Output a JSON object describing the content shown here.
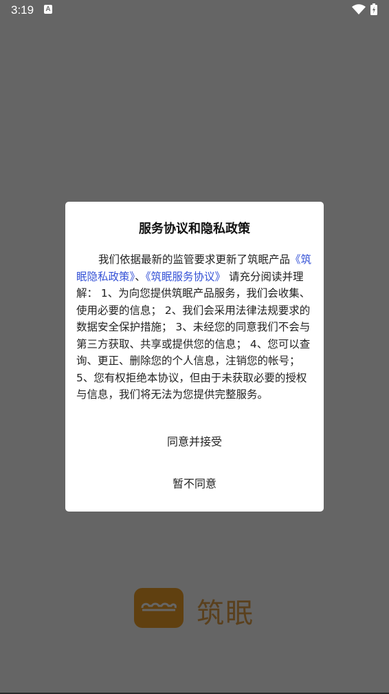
{
  "status_bar": {
    "time": "3:19",
    "notification_icon": "A"
  },
  "splash": {
    "app_name": "筑眠"
  },
  "dialog": {
    "title": "服务协议和隐私政策",
    "body_intro": "我们依据最新的监管要求更新了筑眠产品",
    "privacy_link": "《筑眠隐私政策》",
    "separator": "、",
    "service_link": "《筑眠服务协议》",
    "body_rest": " 请充分阅读并理解： 1、为向您提供筑眠产品服务，我们会收集、使用必要的信息； 2、我们会采用法律法规要求的数据安全保护措施； 3、未经您的同意我们不会与第三方获取、共享或提供您的信息； 4、您可以查询、更正、删除您的个人信息，注销您的帐号； 5、您有权拒绝本协议，但由于未获取必要的授权与信息，我们将无法为您提供完整服务。",
    "agree_label": "同意并接受",
    "disagree_label": "暂不同意"
  },
  "colors": {
    "link": "#3451d6",
    "brand": "#f0a02a"
  }
}
